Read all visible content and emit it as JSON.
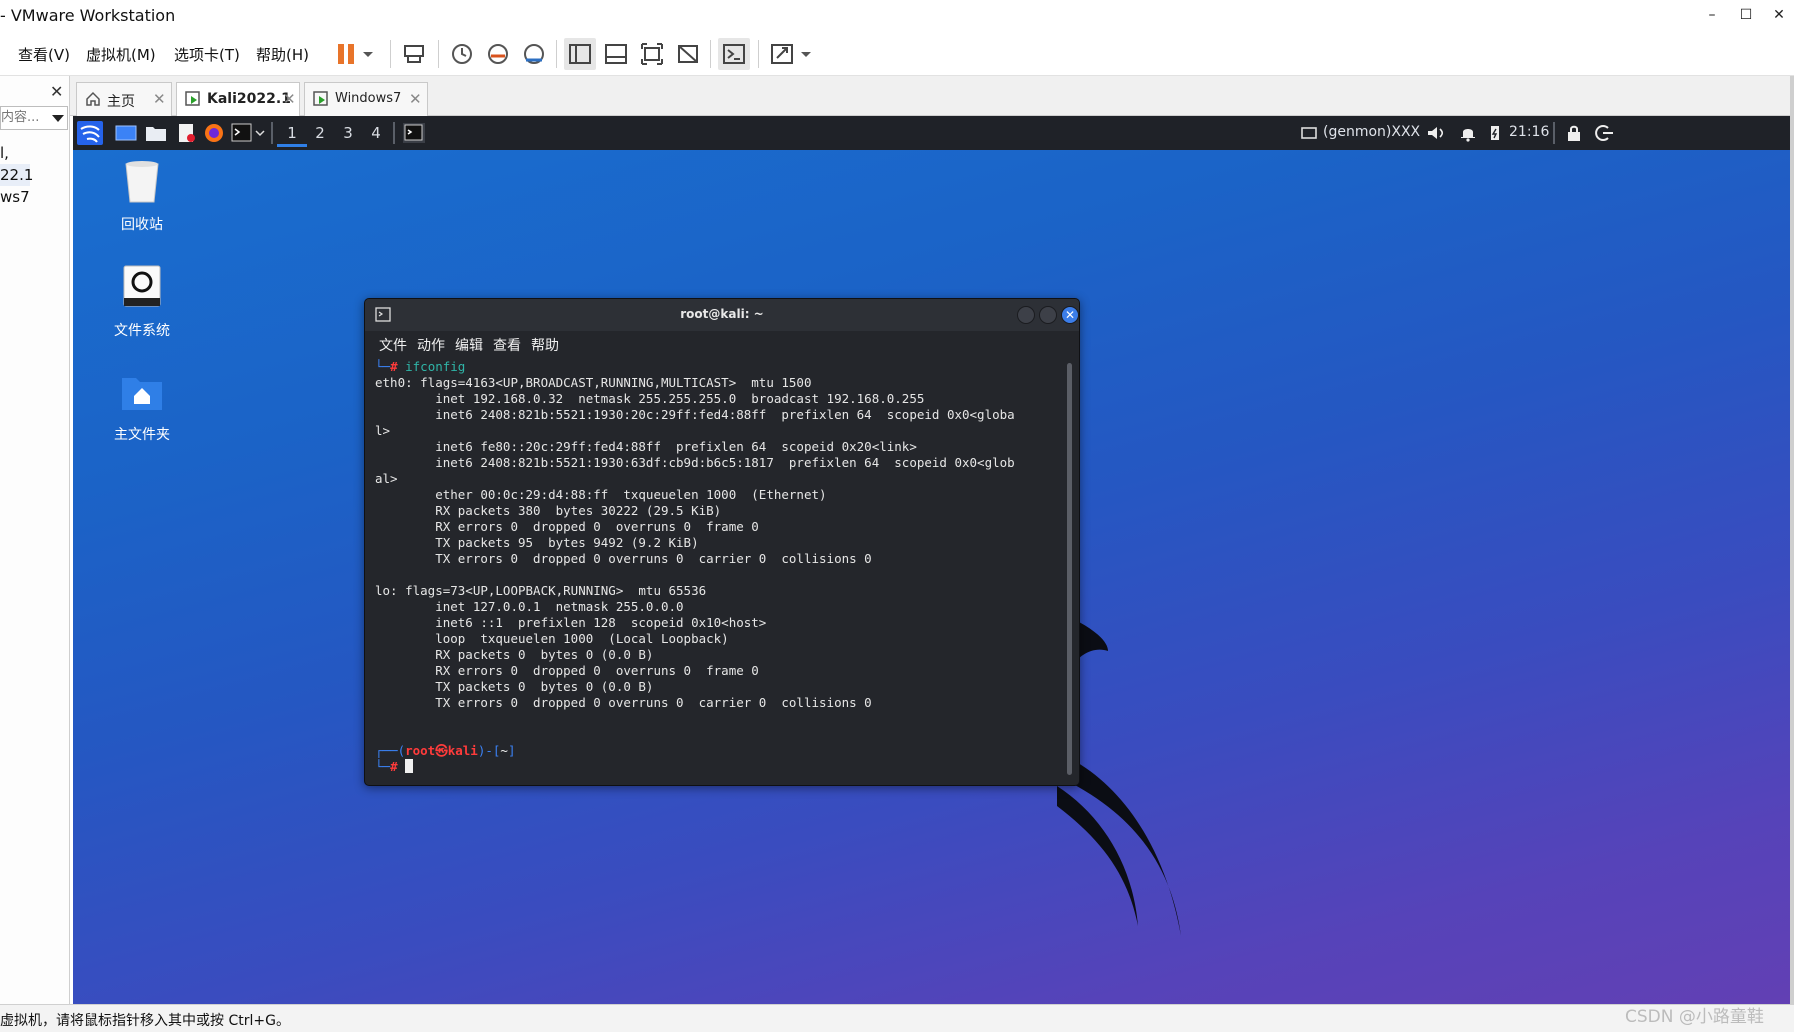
{
  "app": {
    "title": "- VMware Workstation",
    "window_buttons": {
      "minimize": "–",
      "maximize": "☐",
      "close": "✕"
    }
  },
  "menubar": {
    "items": [
      "查看(V)",
      "虚拟机(M)",
      "选项卡(T)",
      "帮助(H)"
    ],
    "toolbar_icons": [
      "pause-icon",
      "send-keys-icon",
      "snapshot-icon",
      "revert-snapshot-icon",
      "snapshot-manager-icon",
      "show-library-icon",
      "thumbnail-icon",
      "full-screen-icon",
      "unity-icon",
      "console-icon",
      "stretch-icon"
    ]
  },
  "library": {
    "close": "✕",
    "search_placeholder": "内容...",
    "items": [
      {
        "label": "l,"
      },
      {
        "label": "22.1"
      },
      {
        "label": "ws7"
      }
    ]
  },
  "tabs": [
    {
      "label": "主页",
      "icon": "home-icon"
    },
    {
      "label": "Kali2022.1",
      "icon": "vm-running-icon"
    },
    {
      "label": "Windows7",
      "icon": "vm-running-icon"
    }
  ],
  "kali_panel": {
    "workspaces": [
      "1",
      "2",
      "3",
      "4"
    ],
    "active_workspace": "1",
    "user": "(genmon)XXX",
    "time": "21:16",
    "colors": {
      "panel_bg": "#1f2228",
      "accent": "#2f7fe7"
    }
  },
  "desktop": {
    "icons": [
      {
        "label": "回收站",
        "icon": "trash-icon"
      },
      {
        "label": "文件系统",
        "icon": "drive-icon"
      },
      {
        "label": "主文件夹",
        "icon": "home-folder-icon"
      }
    ]
  },
  "terminal": {
    "title": "root@kali: ~",
    "menu": [
      "文件",
      "动作",
      "编辑",
      "查看",
      "帮助"
    ],
    "prompt_corner": "└─",
    "prompt_hash": "#",
    "command": "ifconfig",
    "lines": [
      "eth0: flags=4163<UP,BROADCAST,RUNNING,MULTICAST>  mtu 1500",
      "        inet 192.168.0.32  netmask 255.255.255.0  broadcast 192.168.0.255",
      "        inet6 2408:821b:5521:1930:20c:29ff:fed4:88ff  prefixlen 64  scopeid 0x0<globa",
      "l>",
      "        inet6 fe80::20c:29ff:fed4:88ff  prefixlen 64  scopeid 0x20<link>",
      "        inet6 2408:821b:5521:1930:63df:cb9d:b6c5:1817  prefixlen 64  scopeid 0x0<glob",
      "al>",
      "        ether 00:0c:29:d4:88:ff  txqueuelen 1000  (Ethernet)",
      "        RX packets 380  bytes 30222 (29.5 KiB)",
      "        RX errors 0  dropped 0  overruns 0  frame 0",
      "        TX packets 95  bytes 9492 (9.2 KiB)",
      "        TX errors 0  dropped 0 overruns 0  carrier 0  collisions 0",
      "",
      "lo: flags=73<UP,LOOPBACK,RUNNING>  mtu 65536",
      "        inet 127.0.0.1  netmask 255.0.0.0",
      "        inet6 ::1  prefixlen 128  scopeid 0x10<host>",
      "        loop  txqueuelen 1000  (Local Loopback)",
      "        RX packets 0  bytes 0 (0.0 B)",
      "        RX errors 0  dropped 0  overruns 0  frame 0",
      "        TX packets 0  bytes 0 (0.0 B)",
      "        TX errors 0  dropped 0 overruns 0  carrier 0  collisions 0",
      "",
      ""
    ],
    "prompt": {
      "open": "┌──(",
      "user": "root",
      "at": "㉿",
      "host": "kali",
      "close": ")-[",
      "dir": "~",
      "end": "]"
    }
  },
  "statusbar": {
    "text": "虚拟机，请将鼠标指针移入其中或按 Ctrl+G。",
    "watermark": "CSDN @小路童鞋"
  }
}
